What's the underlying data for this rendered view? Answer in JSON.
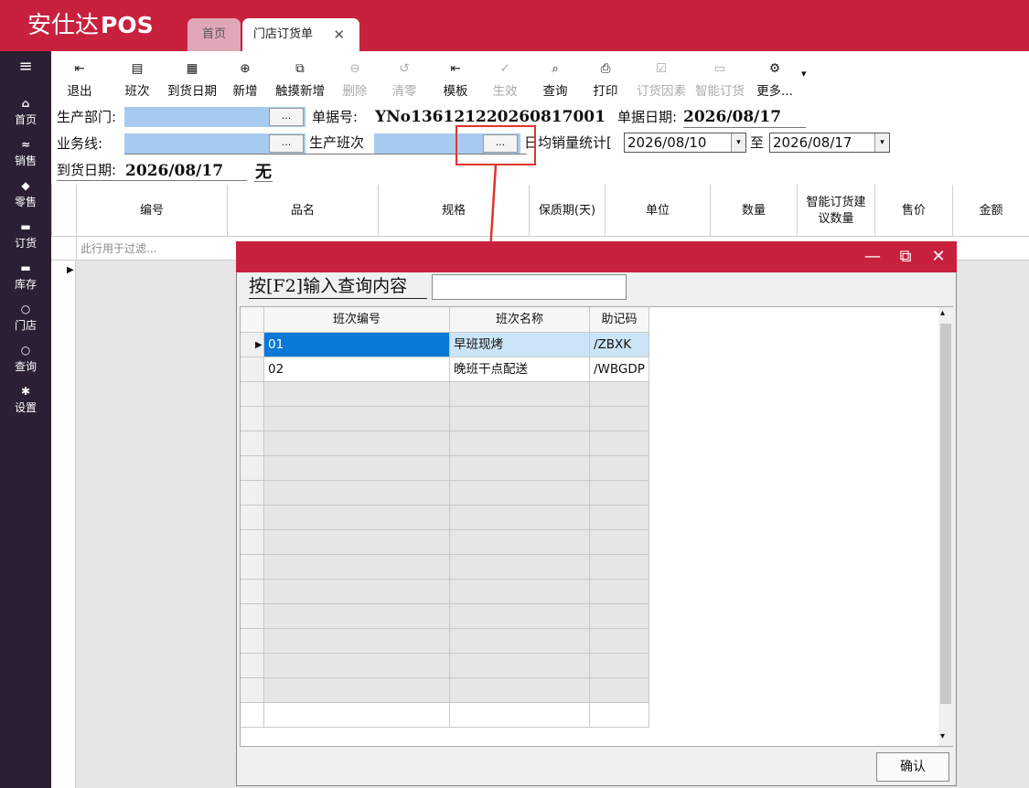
{
  "app": {
    "brand_main": "安仕达",
    "brand_pos": "POS"
  },
  "tabs": [
    {
      "label": "首页"
    },
    {
      "label": "门店订货单",
      "close": "✕"
    }
  ],
  "sidebar": {
    "menu_icon": "≡",
    "items": [
      {
        "icon": "⌂",
        "label": "首页"
      },
      {
        "icon": "≈",
        "label": "销售"
      },
      {
        "icon": "◆",
        "label": "零售"
      },
      {
        "icon": "▬",
        "label": "订货"
      },
      {
        "icon": "▬",
        "label": "库存"
      },
      {
        "icon": "○",
        "label": "门店"
      },
      {
        "icon": "○",
        "label": "查询"
      },
      {
        "icon": "✱",
        "label": "设置"
      }
    ]
  },
  "toolbar": [
    {
      "icon": "⇤",
      "label": "退出",
      "enabled": true
    },
    {
      "icon": "▤",
      "label": "班次",
      "enabled": true
    },
    {
      "icon": "▦",
      "label": "到货日期",
      "enabled": true
    },
    {
      "icon": "⊕",
      "label": "新增",
      "enabled": true
    },
    {
      "icon": "⧉",
      "label": "触摸新增",
      "enabled": true
    },
    {
      "icon": "⊖",
      "label": "删除",
      "enabled": false
    },
    {
      "icon": "↺",
      "label": "清零",
      "enabled": false
    },
    {
      "icon": "⇤",
      "label": "模板",
      "enabled": true
    },
    {
      "icon": "✓",
      "label": "生效",
      "enabled": false
    },
    {
      "icon": "⌕",
      "label": "查询",
      "enabled": true
    },
    {
      "icon": "⎙",
      "label": "打印",
      "enabled": true
    },
    {
      "icon": "☑",
      "label": "订货因素",
      "enabled": false
    },
    {
      "icon": "▭",
      "label": "智能订货",
      "enabled": false
    },
    {
      "icon": "⚙",
      "label": "更多...",
      "enabled": true
    }
  ],
  "toolbar_more_arrow": "▾",
  "form": {
    "dept_label": "生产部门:",
    "dept_value": "",
    "browse_label": "...",
    "doc_no_label": "单据号:",
    "doc_no_value": "YNo136121220260817001",
    "doc_date_label": "单据日期:",
    "doc_date_value": "2026/08/17",
    "line_label": "业务线:",
    "line_value": "",
    "shift_label": "生产班次",
    "shift_value": "",
    "avg_label": "日均销量统计[",
    "date_from": "2026/08/10",
    "to_label": "至",
    "date_to": "2026/08/17",
    "dd_arrow": "▾",
    "arrive_label": "到货日期:",
    "arrive_value": "2026/08/17",
    "arrive_extra": "无"
  },
  "grid": {
    "columns": [
      "编号",
      "品名",
      "规格",
      "保质期(天)",
      "单位",
      "数量",
      "智能订货建议数量",
      "售价",
      "金额"
    ],
    "filter_placeholder": "此行用于过滤...",
    "row_indicator": "▶"
  },
  "dialog": {
    "minimize": "—",
    "restore": "⧉",
    "close": "✕",
    "search_label": "按[F2]输入查询内容",
    "search_value": "",
    "columns": [
      "班次编号",
      "班次名称",
      "助记码"
    ],
    "rows": [
      {
        "code": "01",
        "name": "早班现烤",
        "mnemonic": "/ZBXK",
        "selected": true
      },
      {
        "code": "02",
        "name": "晚班干点配送",
        "mnemonic": "/WBGDP",
        "selected": false
      }
    ],
    "row_indicator": "▶",
    "scroll_up": "▴",
    "scroll_down": "▾",
    "confirm_label": "确认"
  },
  "colors": {
    "brand": "#c8213e",
    "sidebar": "#2c1f33",
    "field_fill": "#a7cbf0",
    "selection": "#0a78d7",
    "row_highlight": "#cce4f7",
    "annotation": "#e0352b"
  }
}
